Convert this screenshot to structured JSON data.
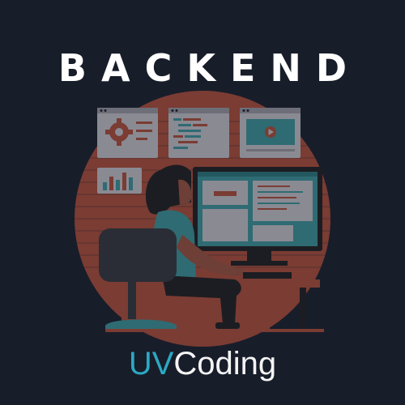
{
  "title": "BACKEND",
  "brand": {
    "prefix": "UV",
    "suffix": "Coding"
  },
  "colors": {
    "background": "#181d2a",
    "title": "#ffffff",
    "brand_accent": "#2ba9c4",
    "brand_text": "#f4f4f4",
    "backdrop_circle": "#7a3c33",
    "panel": "#8a8a93",
    "screen": "#2f6b73",
    "desk": "#7a3c33",
    "chair": "#2a2d35",
    "person_top": "#2f6b73",
    "person_hair": "#1c1d22",
    "person_skin": "#6d3f36"
  },
  "icons": [
    "gear-icon",
    "code-icon",
    "bar-chart-icon",
    "video-play-icon"
  ]
}
